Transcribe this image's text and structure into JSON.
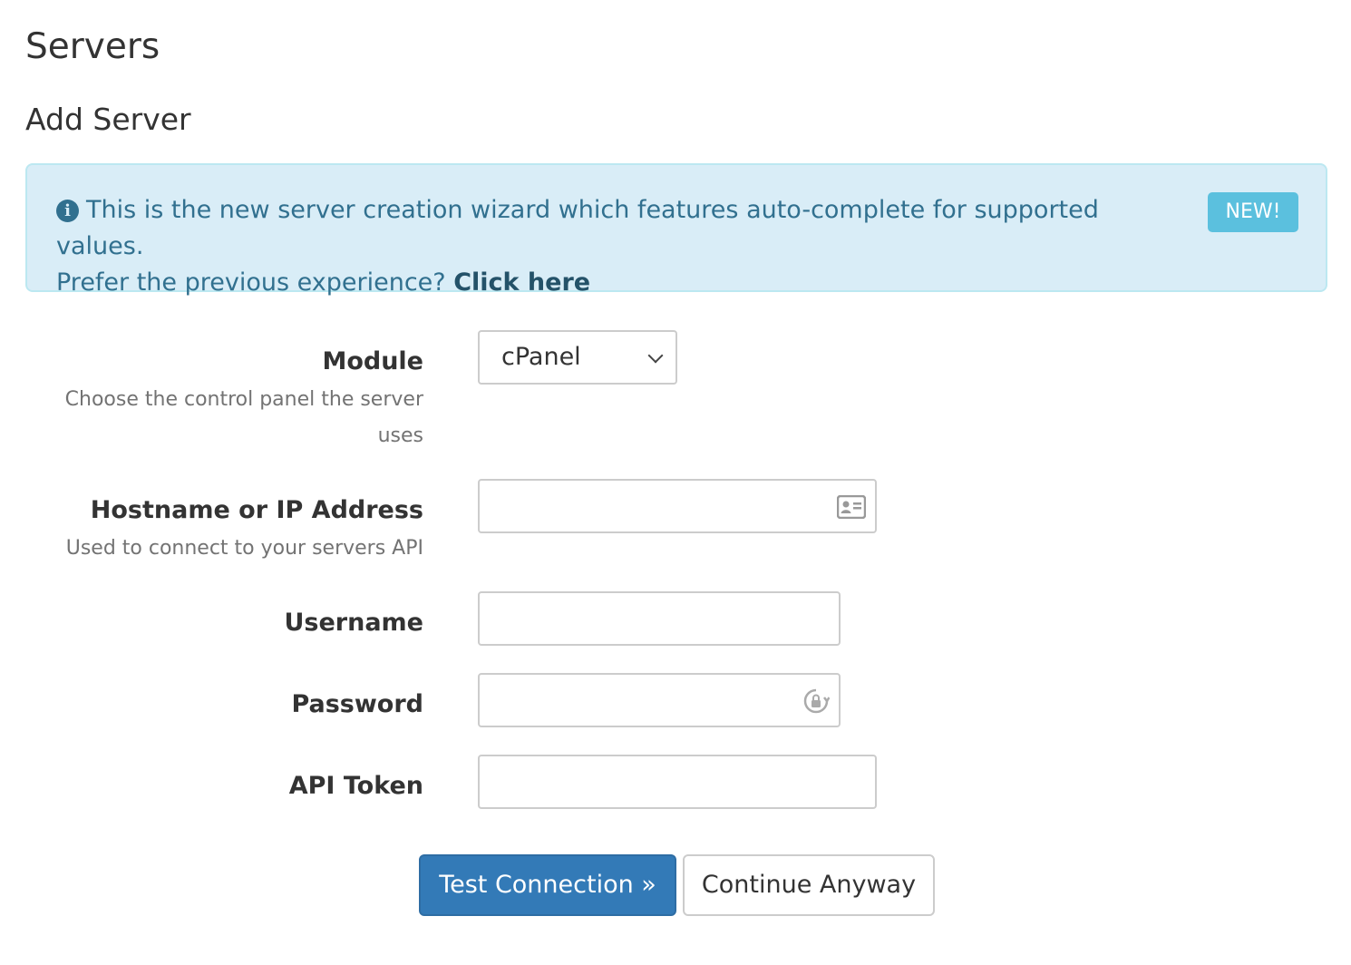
{
  "page": {
    "title": "Servers",
    "section_title": "Add Server"
  },
  "alert": {
    "icon": "info-icon",
    "message": "This is the new server creation wizard which features auto-complete for supported values.",
    "prompt": "Prefer the previous experience?",
    "link_label": "Click here",
    "badge": "NEW!",
    "colors": {
      "background": "#d9edf7",
      "border": "#bce8f1",
      "text": "#31708f",
      "badge": "#5bc0de"
    }
  },
  "form": {
    "module": {
      "label": "Module",
      "help_line1": "Choose the control panel the server",
      "help_line2": "uses",
      "selected": "cPanel",
      "icon": "chevron-down-icon"
    },
    "hostname": {
      "label": "Hostname or IP Address",
      "help": "Used to connect to your servers API",
      "value": "",
      "icon": "contact-card-icon"
    },
    "username": {
      "label": "Username",
      "value": ""
    },
    "password": {
      "label": "Password",
      "value": "",
      "icon": "password-manager-icon"
    },
    "api_token": {
      "label": "API Token",
      "value": ""
    }
  },
  "actions": {
    "test_connection": "Test Connection »",
    "continue_anyway": "Continue Anyway",
    "colors": {
      "primary": "#337ab7"
    }
  }
}
